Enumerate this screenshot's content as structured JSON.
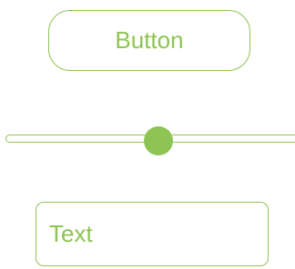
{
  "colors": {
    "accent": "#8dc454",
    "background": "#ffffff"
  },
  "button": {
    "label": "Button"
  },
  "slider": {
    "value": 0.51
  },
  "text_field": {
    "value": "Text"
  }
}
